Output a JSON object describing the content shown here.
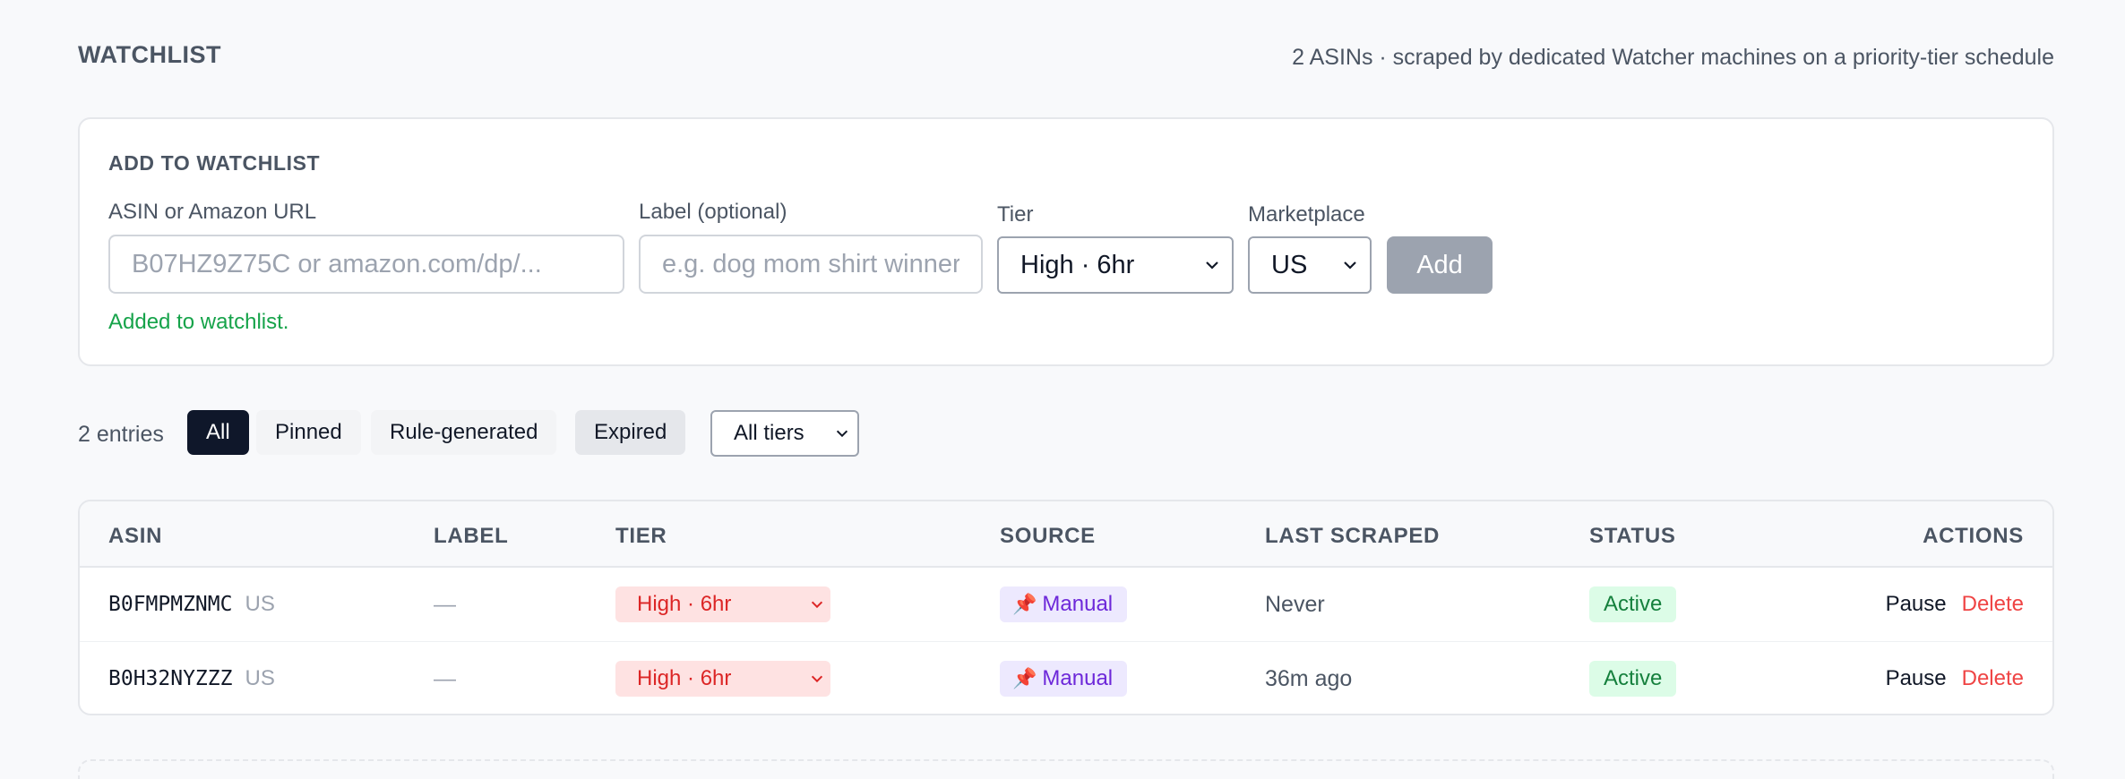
{
  "header": {
    "title": "WATCHLIST",
    "subtitle": "2 ASINs · scraped by dedicated Watcher machines on a priority-tier schedule"
  },
  "add_form": {
    "title": "ADD TO WATCHLIST",
    "asin_label": "ASIN or Amazon URL",
    "asin_placeholder": "B07HZ9Z75C or amazon.com/dp/...",
    "label_label": "Label (optional)",
    "label_placeholder": "e.g. dog mom shirt winner",
    "tier_label": "Tier",
    "tier_value": "High · 6hr",
    "marketplace_label": "Marketplace",
    "marketplace_value": "US",
    "add_button": "Add",
    "success_message": "Added to watchlist."
  },
  "filters": {
    "entries_count": "2 entries",
    "tabs": [
      "All",
      "Pinned",
      "Rule-generated",
      "Expired"
    ],
    "active_tab": "All",
    "tier_filter": "All tiers"
  },
  "table": {
    "columns": [
      "ASIN",
      "LABEL",
      "TIER",
      "SOURCE",
      "LAST SCRAPED",
      "STATUS",
      "ACTIONS"
    ],
    "rows": [
      {
        "asin": "B0FMPMZNMC",
        "marketplace": "US",
        "label": "—",
        "tier": "High · 6hr",
        "source": "Manual",
        "last_scraped": "Never",
        "status": "Active",
        "action_pause": "Pause",
        "action_delete": "Delete"
      },
      {
        "asin": "B0H32NYZZZ",
        "marketplace": "US",
        "label": "—",
        "tier": "High · 6hr",
        "source": "Manual",
        "last_scraped": "36m ago",
        "status": "Active",
        "action_pause": "Pause",
        "action_delete": "Delete"
      }
    ]
  },
  "icons": {
    "source_pin": "pushpin-icon",
    "select_chevron": "chevron-down-icon"
  },
  "colors": {
    "success": "#16a34a",
    "tier_high_bg": "#fee2e2",
    "tier_high_text": "#dc2626",
    "source_bg": "#ede9fe",
    "source_text": "#6d28d9",
    "status_bg": "#dcfce7",
    "status_text": "#15803d",
    "delete": "#ef4444",
    "active_tab_bg": "#0f172a"
  }
}
